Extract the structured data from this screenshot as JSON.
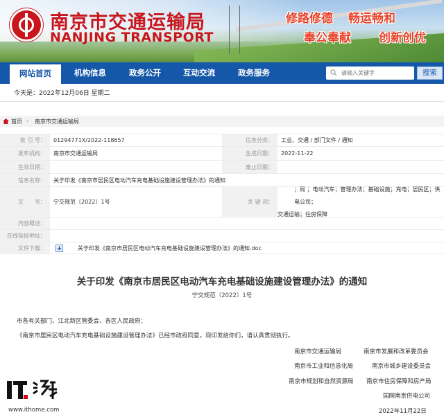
{
  "header": {
    "title": "南京市交通运输局",
    "subtitle": "NANJING TRANSPORT",
    "slogans": [
      "修路修德",
      "畅运畅和",
      "奉公奉献",
      "创新创优"
    ]
  },
  "nav": {
    "items": [
      "网站首页",
      "机构信息",
      "政务公开",
      "互动交流",
      "政务服务"
    ],
    "search_placeholder": "请输入关键字",
    "search_button": "搜索"
  },
  "date_line": "今天是：2022年12月06日 星期二",
  "breadcrumb": [
    "首页",
    "南京市交通运输局"
  ],
  "info": {
    "index_label": "索 引 号：",
    "index_value": "01294771X/2022-118657",
    "category_label": "信息分类：",
    "category_value": "工业、交通 / 部门文件 / 通知",
    "publisher_label": "发布机构：",
    "publisher_value": "南京市交通运输局",
    "created_label": "生成日期：",
    "created_value": "2022-11-22",
    "effective_label": "生效日期：",
    "repeal_label": "废止日期：",
    "name_label": "信息名称：",
    "name_value": "关于印发《南京市居民区电动汽车充电基础设施建设管理办法》的通知",
    "docno_label": "文　　号：",
    "docno_value": "宁交规范〔2022〕1号",
    "keywords_label": "关 键 词：",
    "keywords_line1": "；局 ；电动汽车；管理办法；基础设施；充电；居民区；供电公司；",
    "keywords_line2": "交通运输；住房保障",
    "summary_label": "内容概述：",
    "online_label": "在线链接地址：",
    "download_label": "文件下载：",
    "download_value": "关于印发《南京市居民区电动汽车充电基础设施建设管理办法》的通知.doc"
  },
  "article": {
    "title": "关于印发《南京市居民区电动汽车充电基础设施建设管理办法》的通知",
    "doc_no": "宁交规范〔2022〕1号",
    "salutation": "市各有关部门、江北新区管委会、各区人民政府：",
    "body": "《南京市居民区电动汽车充电基础设施建设管理办法》已经市政府同意，现印发给你们，请认真贯彻执行。",
    "signers": [
      [
        "南京市交通运输局",
        "南京市发展和改革委员会"
      ],
      [
        "南京市工业和信息化局",
        "南京市城乡建设委员会"
      ],
      [
        "南京市规划和自然资源局",
        "南京市住房保障和房产局"
      ],
      [
        "",
        "国网南京供电公司"
      ]
    ],
    "date": "2022年11月22日"
  },
  "watermark": {
    "url": "www.ithome.com"
  },
  "colors": {
    "brand_red": "#c8161d",
    "nav_blue": "#1557a8",
    "slogan_red": "#e8432a"
  }
}
